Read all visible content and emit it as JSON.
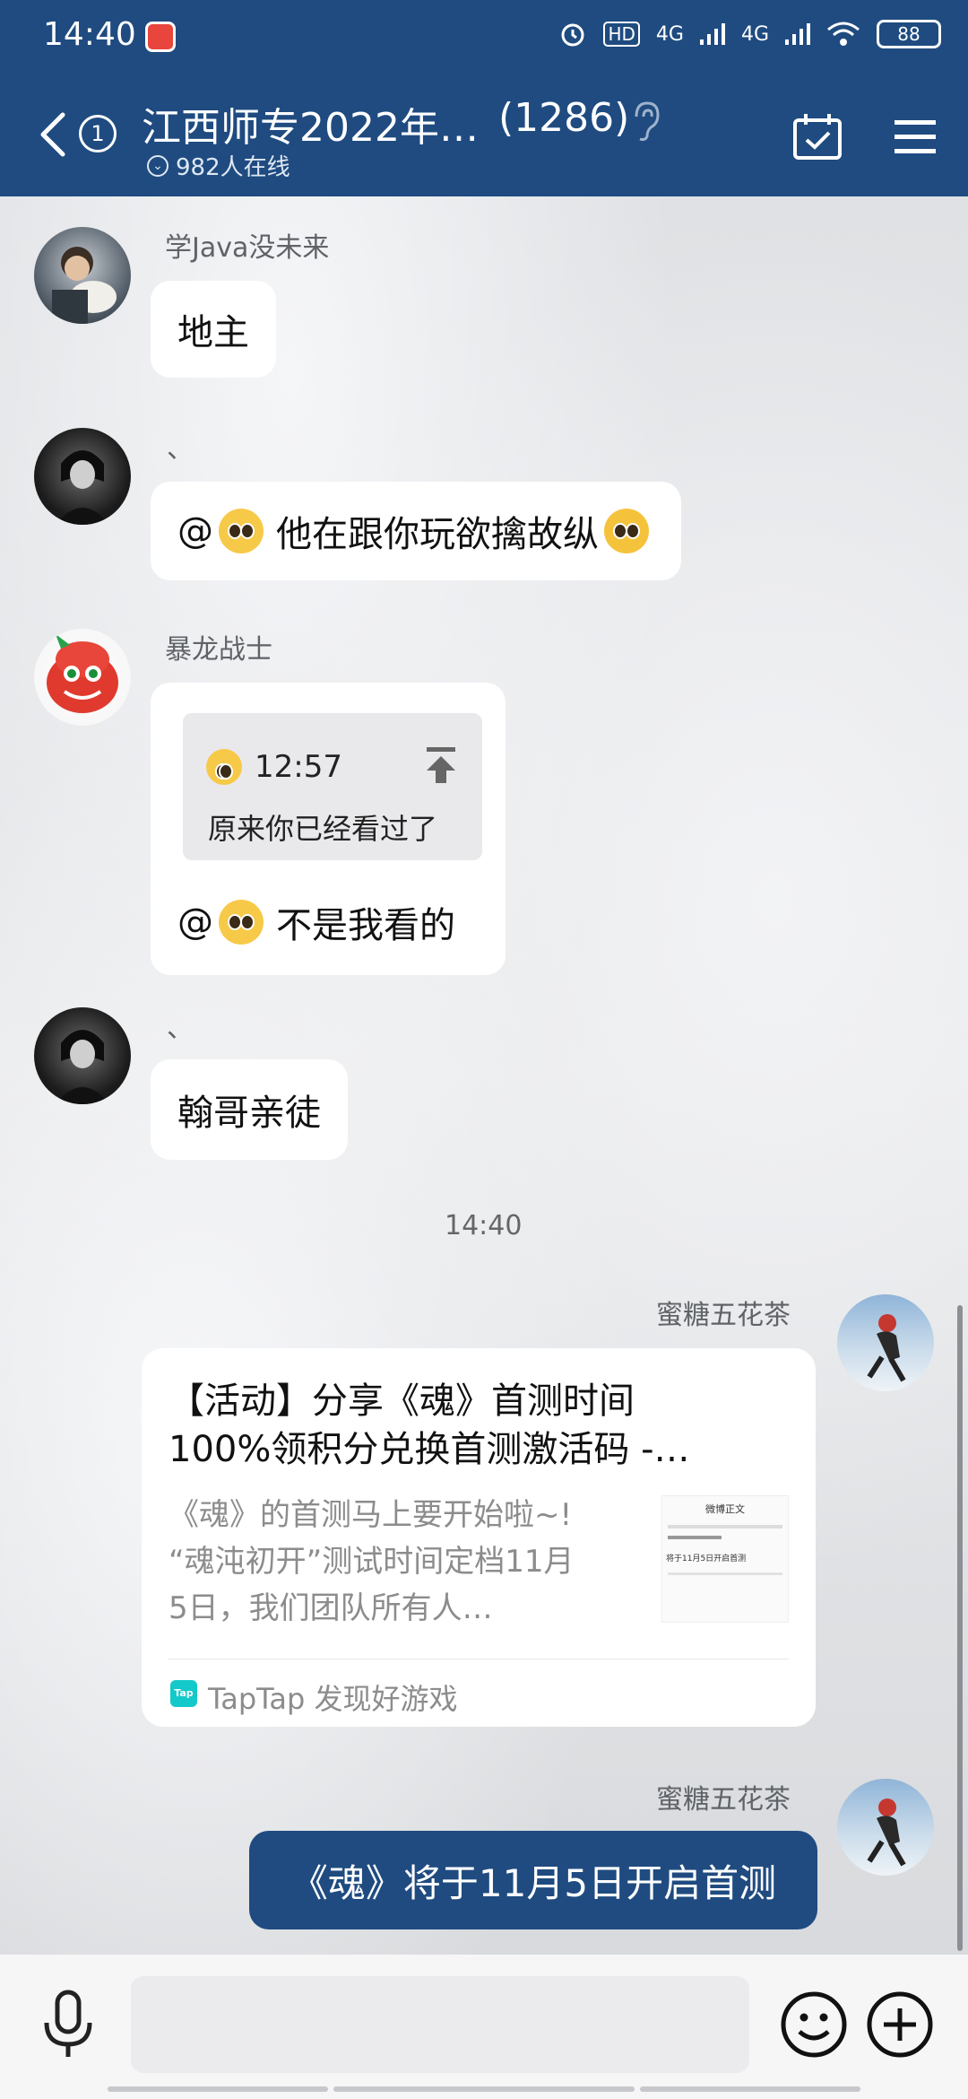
{
  "status": {
    "time": "14:40",
    "battery": "88",
    "hd": "HD",
    "net1": "4G",
    "net2": "4G"
  },
  "header": {
    "title": "江西师专2022年…",
    "member_count": "(1286)",
    "online": "982人在线",
    "unread": "1"
  },
  "messages": [
    {
      "sender": "学Java没未来",
      "text": "地主"
    },
    {
      "sender": "、",
      "text_prefix": "@",
      "text": "他在跟你玩欲擒故纵"
    },
    {
      "sender": "暴龙战士",
      "quote_time": "12:57",
      "quote_text": "原来你已经看过了",
      "text_prefix": "@",
      "text": "不是我看的"
    },
    {
      "sender": "、",
      "text": "翰哥亲徒"
    }
  ],
  "timestamp": "14:40",
  "self_messages": [
    {
      "sender": "蜜糖五花茶",
      "card": {
        "title_line1": "【活动】分享《魂》首测时间",
        "title_line2": "100%领积分兑换首测激活码 -…",
        "desc_line1": "《魂》的首测马上要开始啦~!",
        "desc_line2": "“魂沌初开”测试时间定档11月",
        "desc_line3": "5日，我们团队所有人…",
        "thumb_title": "微博正文",
        "thumb_line": "将于11月5日开启首测",
        "source_badge": "Tap",
        "source": "TapTap 发现好游戏"
      }
    },
    {
      "sender": "蜜糖五花茶",
      "text": "《魂》将于11月5日开启首测"
    }
  ],
  "colors": {
    "header": "#1f4b80",
    "self_bubble": "#1f4b80",
    "taptap": "#14c9c9"
  }
}
